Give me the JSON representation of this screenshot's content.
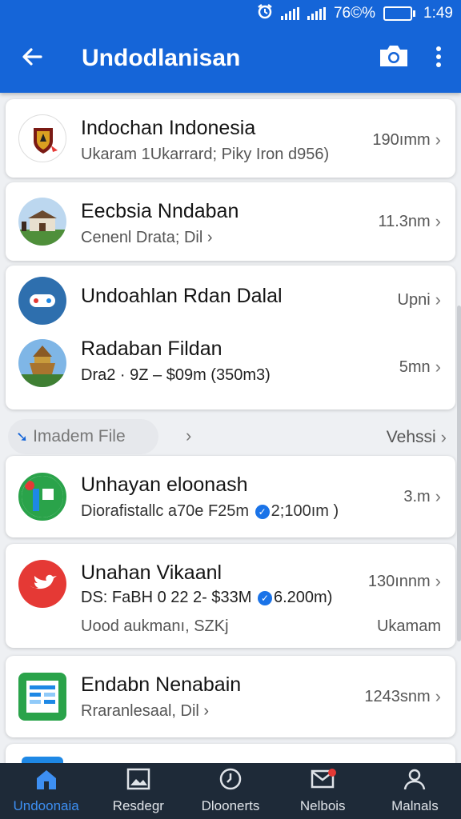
{
  "status_bar": {
    "battery": "76©%",
    "time": "1:49",
    "battery_level": 0.72
  },
  "app_bar": {
    "title": "Undodlanisan",
    "icons": {
      "back": "arrow-back-icon",
      "camera": "camera-icon",
      "more": "more-vert-icon"
    }
  },
  "items": [
    {
      "name": "Indochan Indonesia",
      "detail": "Ukaram 1Ukarrard; Piky Iron d956)",
      "meta": "190ımm"
    },
    {
      "name": "Eecbsia Nndaban",
      "detail": "Cenenl Drata; Dil ›",
      "meta": "11.3nm"
    },
    {
      "name": "Undoahlan Rdan Dalal",
      "detail": "",
      "meta": "Upni"
    },
    {
      "name": "Radaban Fildan",
      "detail": "Dra2 · 9Z – $09m (350m3)",
      "meta": "5mn"
    },
    {
      "name": "Unhayan eloonash",
      "detail_before": "Diorafistallc a70e F25m",
      "detail_after": "2;100ım )",
      "meta": "3.m"
    },
    {
      "name": "Unahan Vikaanl",
      "detail_before": "DS: FaBH 0 22 2- $33M",
      "detail_after": "6.200m)",
      "detail2": "Uood aukmanı, SZKj",
      "meta": "130ınnm",
      "meta2": "Ukamam"
    },
    {
      "name": "Endabn Nenabain",
      "detail": "Rraranlesaal, Dil ›",
      "meta": "1243snm"
    }
  ],
  "section": {
    "label": "Imadem File",
    "right_label": "Vehssi"
  },
  "bottom_nav": [
    {
      "label": "Undoonaia",
      "icon": "home-icon",
      "active": true
    },
    {
      "label": "Resdegr",
      "icon": "image-icon",
      "active": false
    },
    {
      "label": "Dloonerts",
      "icon": "clock-icon",
      "active": false
    },
    {
      "label": "Nelbois",
      "icon": "mail-icon",
      "active": false
    },
    {
      "label": "Malnals",
      "icon": "person-icon",
      "active": false
    }
  ],
  "colors": {
    "primary": "#1565d8",
    "nav_bg": "#1e2a38",
    "nav_active": "#3d8ff2",
    "verified": "#1a73e8"
  }
}
